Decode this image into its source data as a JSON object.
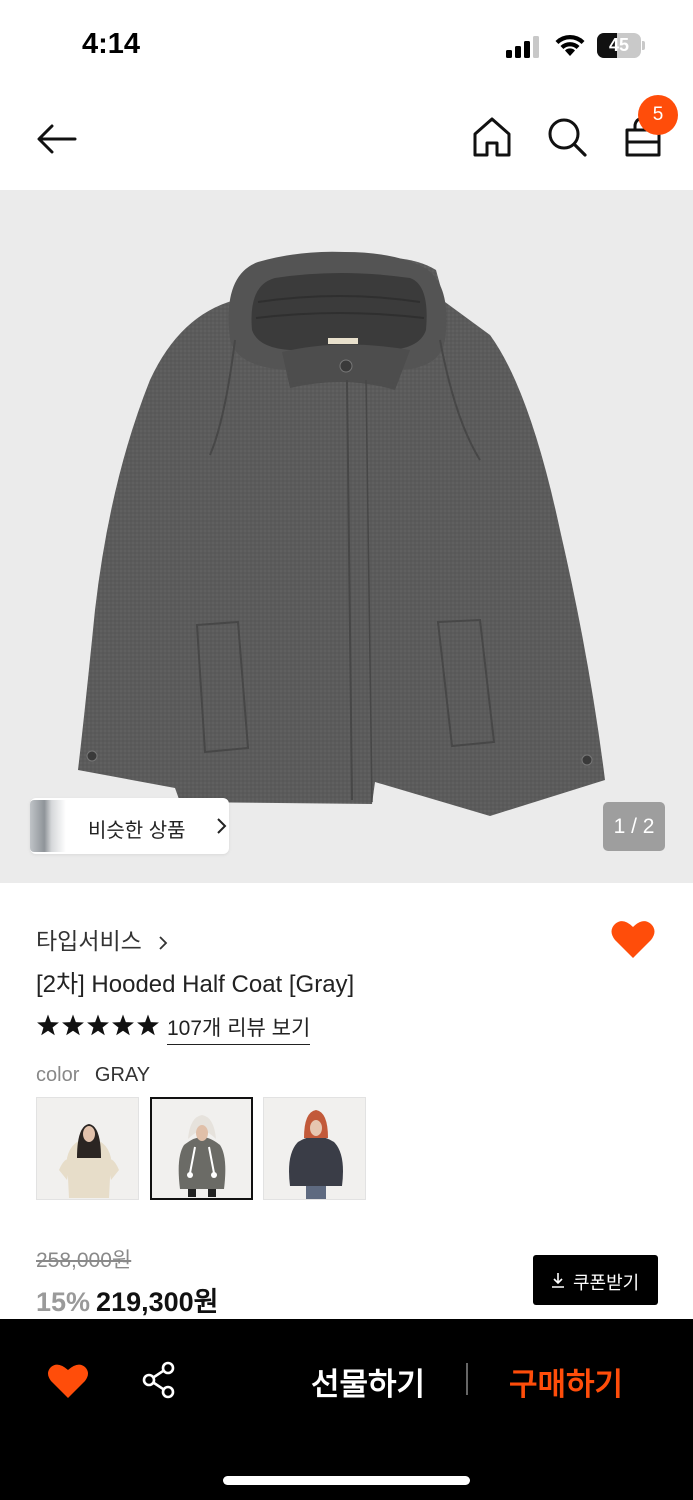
{
  "status_bar": {
    "time": "4:14",
    "battery_level": "45",
    "battery_fraction": 0.45
  },
  "nav": {
    "back_icon": "arrow-left-icon",
    "home_icon": "home-icon",
    "search_icon": "search-icon",
    "bag_icon": "shopping-bag-icon",
    "cart_count": "5"
  },
  "gallery": {
    "similar_label": "비슷한 상품",
    "page_indicator": "1 / 2",
    "current_page": 1,
    "total_pages": 2
  },
  "product": {
    "brand": "타입서비스",
    "title": "[2차] Hooded Half Coat [Gray]",
    "rating_stars": 5,
    "review_link": "107개 리뷰 보기",
    "color_label": "color",
    "color_value": "GRAY",
    "swatches": [
      "ivory",
      "gray",
      "navy"
    ],
    "selected_swatch": 1
  },
  "price": {
    "original": "258,000원",
    "discount": "15%",
    "sale": "219,300원",
    "coupon_label": "쿠폰받기"
  },
  "bottom_bar": {
    "gift_label": "선물하기",
    "buy_label": "구매하기",
    "share_icon": "share-icon",
    "wish_icon": "heart-icon"
  },
  "colors": {
    "accent": "#ff4d0a",
    "bottom_bar_bg": "#000000",
    "image_bg": "#ebebeb"
  }
}
